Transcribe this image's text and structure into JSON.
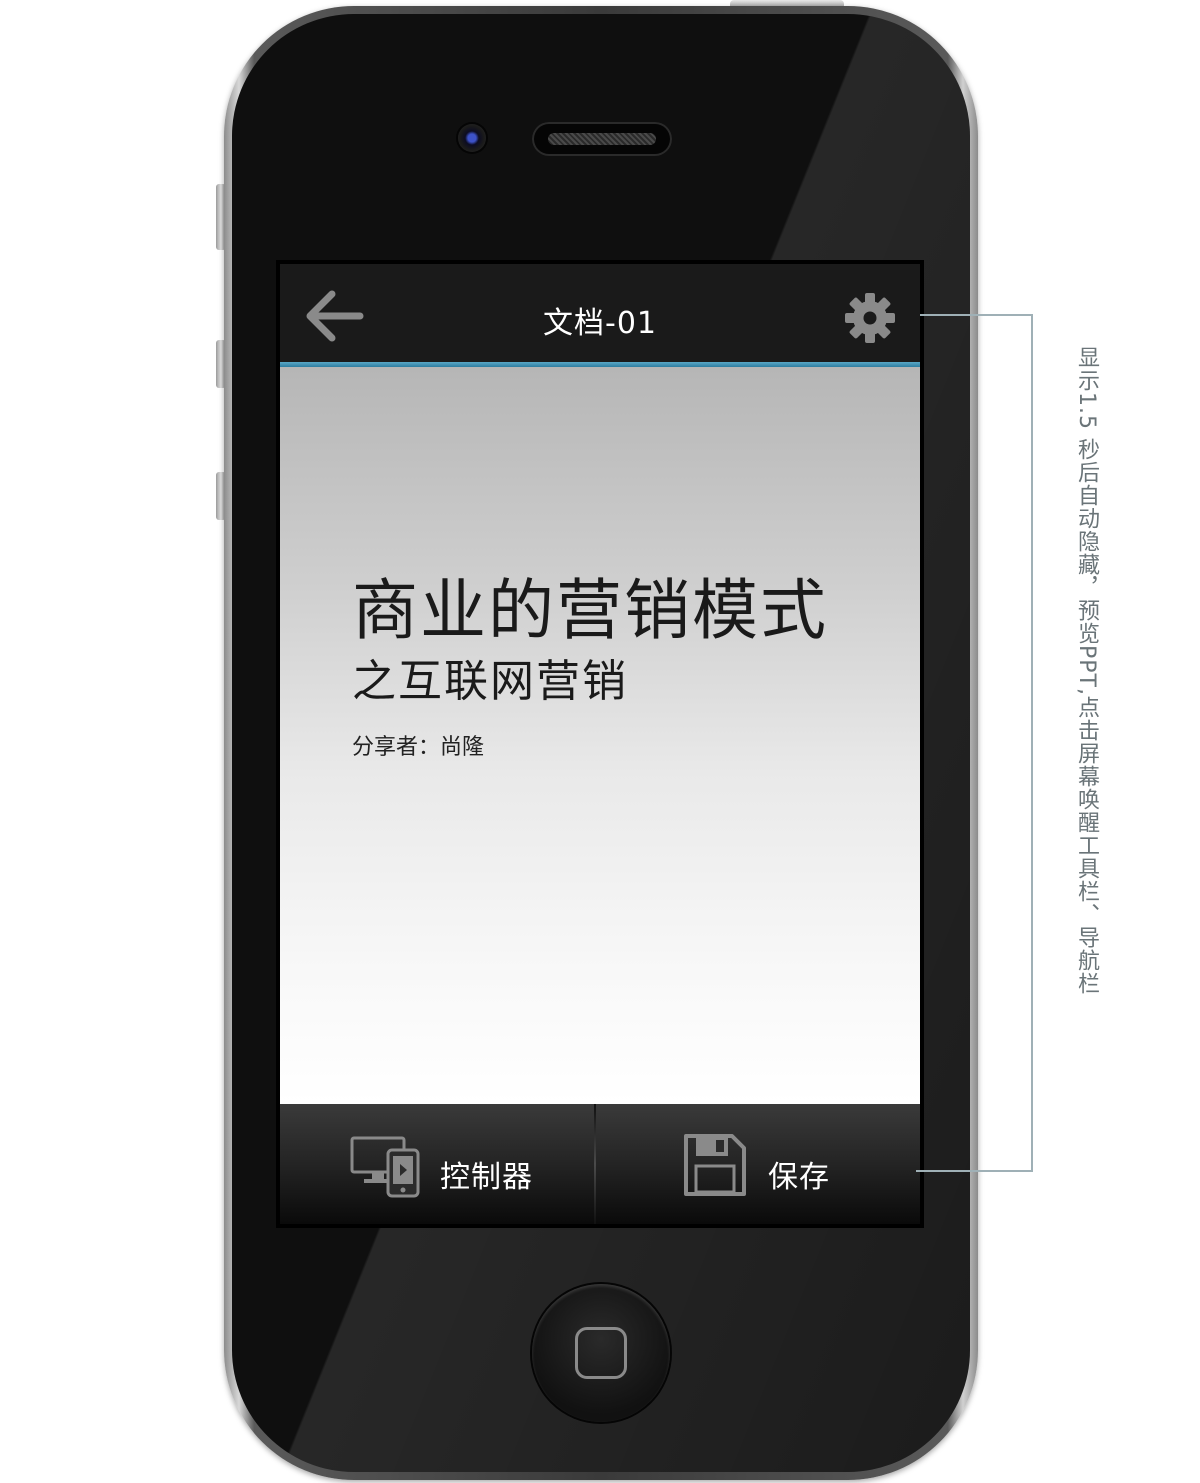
{
  "app": {
    "nav_title": "文档-01",
    "accent_color": "#3d95bb",
    "nav_background": "#1a1a1a"
  },
  "navbar": {
    "back_icon": "arrow-left-icon",
    "settings_icon": "gear-icon"
  },
  "slide": {
    "title": "商业的营销模式",
    "subtitle": "之互联网营销",
    "author": "分享者：尚隆"
  },
  "toolbar": {
    "controller_label": "控制器",
    "controller_icon": "monitor-phone-icon",
    "save_label": "保存",
    "save_icon": "floppy-disk-icon"
  },
  "annotation": {
    "text": "显示1.5 秒后自动隐藏，预览PPT,点击屏幕唤醒工具栏、导航栏"
  }
}
